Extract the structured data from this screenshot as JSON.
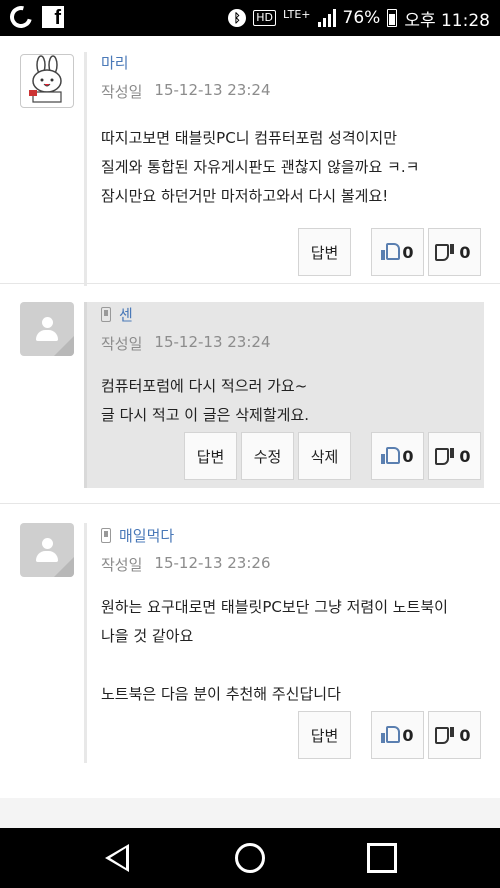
{
  "status_bar": {
    "hd": "HD",
    "network": "LTE+",
    "battery_percent": "76%",
    "time": "오후 11:28"
  },
  "comments": [
    {
      "author": "마리",
      "meta_label": "작성일",
      "date": "15-12-13 23:24",
      "lines": [
        "따지고보면 태블릿PC니 컴퓨터포럼 성격이지만",
        "질게와 통합된 자유게시판도 괜찮지 않을까요 ㅋ.ㅋ",
        "잠시만요 하던거만 마저하고와서 다시 볼게요!"
      ],
      "reply_label": "답변",
      "likes": "0",
      "dislikes": "0"
    },
    {
      "author": "센",
      "meta_label": "작성일",
      "date": "15-12-13 23:24",
      "lines": [
        "컴퓨터포럼에 다시 적으러 가요~",
        "글 다시 적고 이 글은 삭제할게요."
      ],
      "reply_label": "답변",
      "edit_label": "수정",
      "delete_label": "삭제",
      "likes": "0",
      "dislikes": "0"
    },
    {
      "author": "매일먹다",
      "meta_label": "작성일",
      "date": "15-12-13 23:26",
      "lines": [
        "원하는 요구대로면 태블릿PC보단 그냥 저렴이 노트북이",
        "나을 것 같아요",
        "",
        "노트북은 다음 분이 추천해 주신답니다"
      ],
      "reply_label": "답변",
      "likes": "0",
      "dislikes": "0"
    }
  ]
}
